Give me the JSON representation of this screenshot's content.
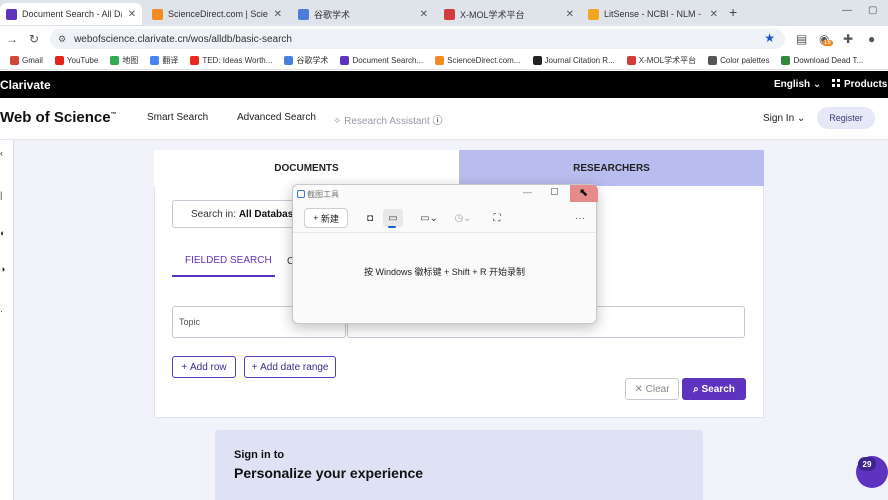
{
  "browser": {
    "tabs": [
      {
        "title": "Document Search - All Datal",
        "color": "#5e33bf"
      },
      {
        "title": "ScienceDirect.com | Science",
        "color": "#f28b1f"
      },
      {
        "title": "谷歌学术",
        "color": "#4a7ddc"
      },
      {
        "title": "X-MOL学术平台",
        "color": "#d23c3c"
      },
      {
        "title": "LitSense - NCBI - NLM - NIH",
        "color": "#f2a51f"
      }
    ],
    "url": "webofscience.clarivate.cn/wos/alldb/basic-search",
    "extension_badge": "16",
    "bookmarks": [
      {
        "label": "Gmail",
        "color": "#d44638"
      },
      {
        "label": "YouTube",
        "color": "#e62117"
      },
      {
        "label": "地图",
        "color": "#34a853"
      },
      {
        "label": "翻译",
        "color": "#4285f4"
      },
      {
        "label": "TED: Ideas Worth...",
        "color": "#e62b1e"
      },
      {
        "label": "谷歌学术",
        "color": "#4a7ddc"
      },
      {
        "label": "Document Search...",
        "color": "#5e33bf"
      },
      {
        "label": "ScienceDirect.com...",
        "color": "#f28b1f"
      },
      {
        "label": "Journal Citation R...",
        "color": "#222222"
      },
      {
        "label": "X-MOL学术平台",
        "color": "#d23c3c"
      },
      {
        "label": "Color palettes",
        "color": "#555555"
      },
      {
        "label": "Download Dead T...",
        "color": "#2f8a3c"
      }
    ]
  },
  "clarivate": {
    "logo": "Clarivate",
    "language": "English ⌄",
    "products": "Products"
  },
  "wos": {
    "brand": "Web of Science",
    "brand_tm": "™",
    "nav": {
      "smart_search": "Smart Search",
      "advanced_search": "Advanced Search",
      "research_assistant": "Research Assistant"
    },
    "sign_in": "Sign In ⌄",
    "register": "Register"
  },
  "search": {
    "tab_documents": "DOCUMENTS",
    "tab_researchers": "RESEARCHERS",
    "search_in_label": "Search in:",
    "search_in_value": "All Database",
    "fielded_search": "FIELDED SEARCH",
    "cited_tab_fragment": "C",
    "topic_field": "Topic",
    "add_row": "Add row",
    "add_date_range": "Add date range",
    "clear": "Clear",
    "search": "Search"
  },
  "personalize": {
    "subtitle": "Sign in to",
    "title": "Personalize your experience"
  },
  "notification_count": "29",
  "snipping_tool": {
    "title": "截图工具",
    "new_button": "新建",
    "message": "按 Windows 徽标键 + Shift + R 开始录制"
  },
  "colors": {
    "accent": "#5e33bf",
    "researchers_tab": "#b8bcee",
    "page_bg": "#f1f2fa"
  }
}
